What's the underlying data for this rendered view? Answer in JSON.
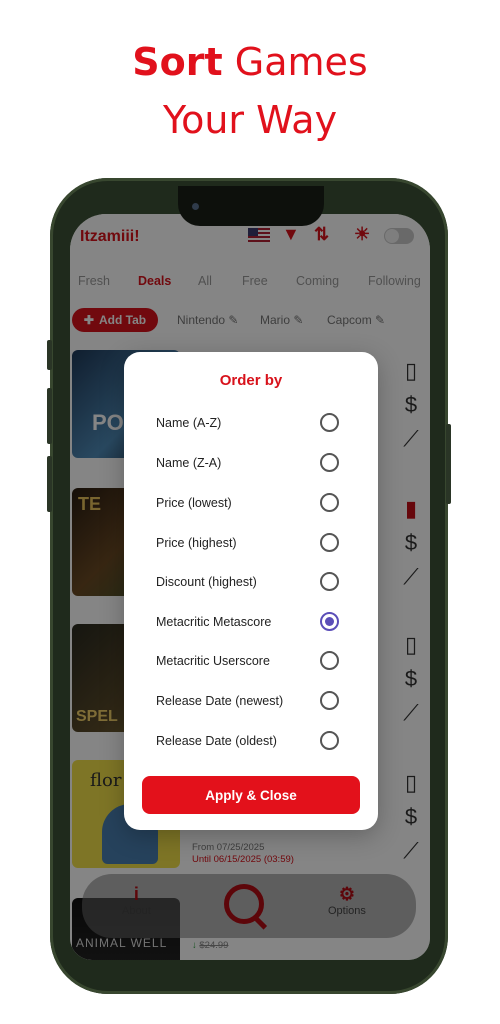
{
  "headline": {
    "bold": "Sort",
    "rest1": " Games",
    "line2": "Your Way"
  },
  "app": {
    "title": "Itzamiii!",
    "tabs": [
      "Fresh",
      "Deals",
      "All",
      "Free",
      "Coming",
      "Following"
    ],
    "active_tab": "Deals",
    "add_tab_label": "Add Tab",
    "subtabs": [
      "Nintendo",
      "Mario",
      "Capcom"
    ],
    "cards": [
      {
        "image_text": "PO",
        "bookmarked": false
      },
      {
        "image_text": "TE",
        "bookmarked": true
      },
      {
        "image_text": "SPEL",
        "bookmarked": false
      },
      {
        "image_text": "flor",
        "bookmarked": false,
        "from_date": "From 07/25/2025",
        "until": "Until 06/15/2025 (03:59)"
      },
      {
        "image_text": "ANIMAL WELL",
        "old_price": "$24.99"
      }
    ],
    "bottom_nav": {
      "about": "About",
      "options": "Options"
    }
  },
  "modal": {
    "title": "Order by",
    "options": [
      "Name (A-Z)",
      "Name (Z-A)",
      "Price (lowest)",
      "Price (highest)",
      "Discount (highest)",
      "Metacritic Metascore",
      "Metacritic Userscore",
      "Release Date (newest)",
      "Release Date (oldest)"
    ],
    "selected_index": 5,
    "apply_label": "Apply & Close"
  },
  "colors": {
    "brand_red": "#e1111c",
    "radio_selected": "#5b4eb8"
  }
}
